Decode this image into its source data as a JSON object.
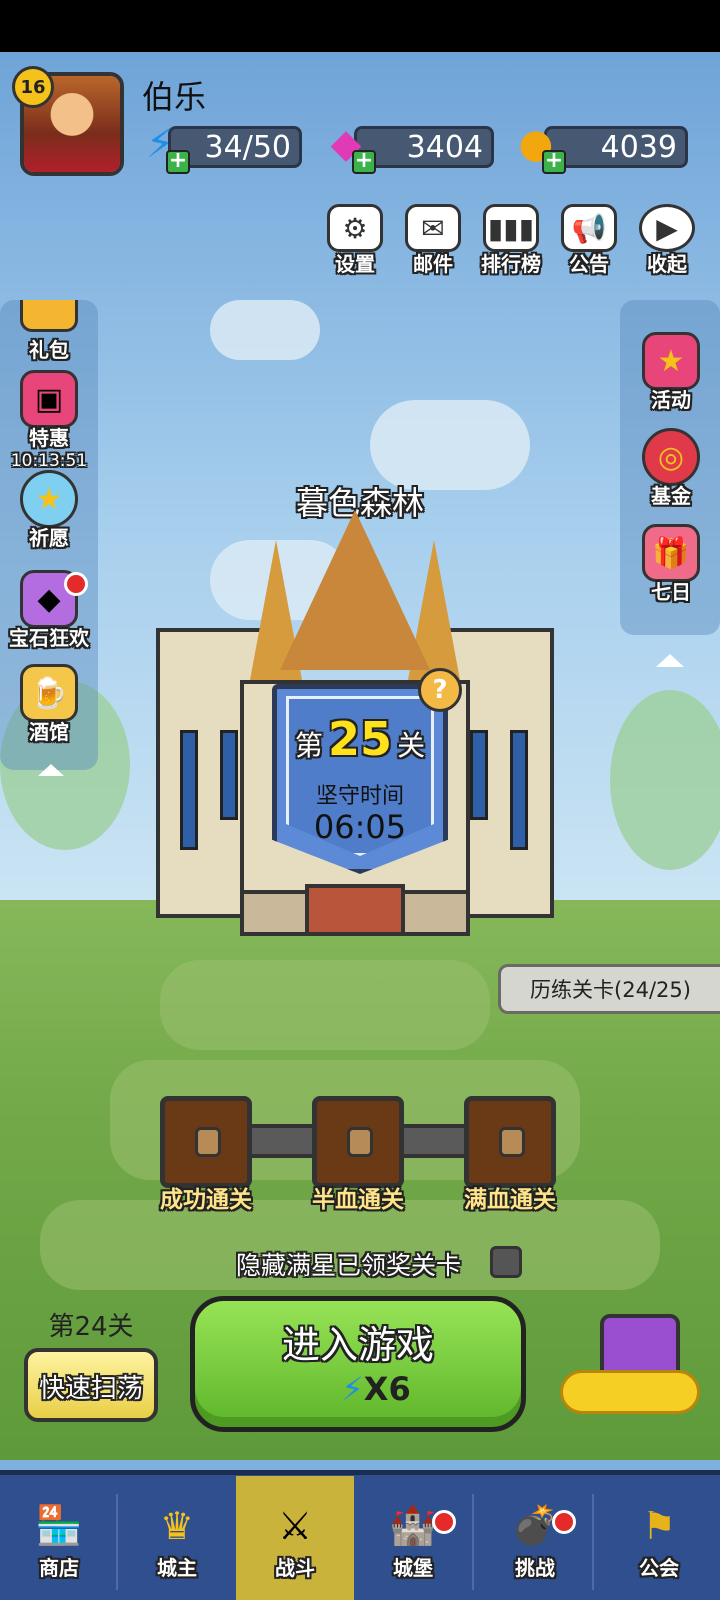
{
  "player": {
    "name": "伯乐",
    "level": "16"
  },
  "resources": {
    "energy": "34/50",
    "gems": "3404",
    "coins": "4039"
  },
  "toolbar": [
    {
      "label": "设置",
      "icon": "gear-icon"
    },
    {
      "label": "邮件",
      "icon": "mail-icon"
    },
    {
      "label": "排行榜",
      "icon": "ranking-icon"
    },
    {
      "label": "公告",
      "icon": "megaphone-icon"
    },
    {
      "label": "收起",
      "icon": "collapse-icon"
    }
  ],
  "left_menu": [
    {
      "label": "礼包",
      "icon": "gift-pack-icon"
    },
    {
      "label": "特惠",
      "icon": "special-offer-icon",
      "timer": "10:13:51"
    },
    {
      "label": "祈愿",
      "icon": "wish-icon"
    },
    {
      "label": "宝石狂欢",
      "icon": "gem-carnival-icon"
    },
    {
      "label": "酒馆",
      "icon": "tavern-icon"
    }
  ],
  "right_menu": [
    {
      "label": "活动",
      "icon": "event-icon"
    },
    {
      "label": "基金",
      "icon": "fund-icon"
    },
    {
      "label": "七日",
      "icon": "seven-day-icon"
    }
  ],
  "stage": {
    "area_name": "暮色森林",
    "prefix": "第",
    "number": "25",
    "suffix": "关",
    "hold_label": "坚守时间",
    "hold_time": "06:05"
  },
  "trial": {
    "label": "历练关卡(24/25)"
  },
  "chests": [
    {
      "label": "成功通关"
    },
    {
      "label": "半血通关"
    },
    {
      "label": "满血通关"
    }
  ],
  "hide_toggle": {
    "label": "隐藏满星已领奖关卡",
    "checked": false
  },
  "sweep": {
    "stage": "第24关",
    "label": "快速扫荡"
  },
  "enter": {
    "label": "进入游戏",
    "cost": "X6"
  },
  "nav": [
    {
      "label": "商店",
      "icon": "shop-icon"
    },
    {
      "label": "城主",
      "icon": "crown-icon"
    },
    {
      "label": "战斗",
      "icon": "crossed-swords-icon",
      "active": true
    },
    {
      "label": "城堡",
      "icon": "castle-icon"
    },
    {
      "label": "挑战",
      "icon": "challenge-icon"
    },
    {
      "label": "公会",
      "icon": "guild-banner-icon"
    }
  ],
  "colors": {
    "nav_bg": "#2f4f8e",
    "enter_green": "#6cc234",
    "stage_yellow": "#ffe21b",
    "active_nav": "#c9b33b"
  }
}
